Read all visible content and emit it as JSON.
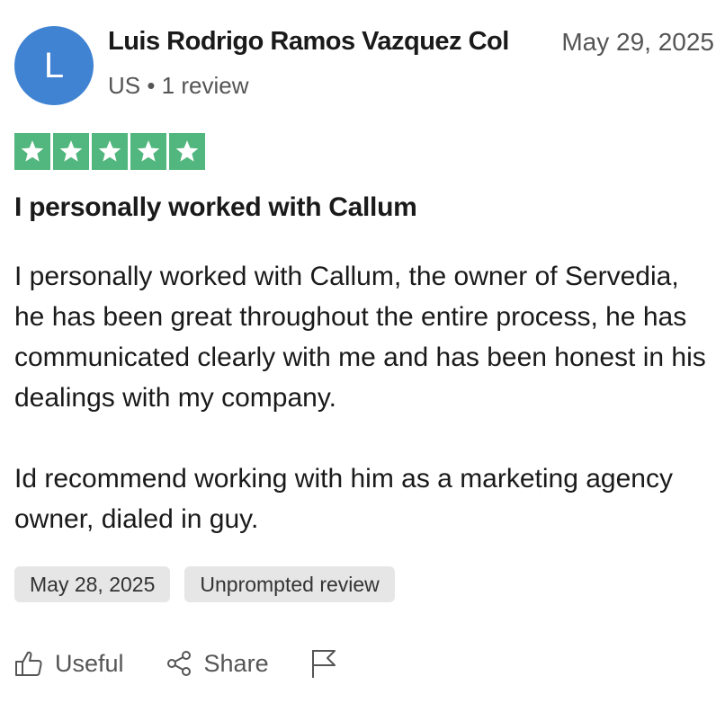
{
  "review": {
    "avatar_initial": "L",
    "avatar_color": "#3f83d2",
    "reviewer_name": "Luis Rodrigo Ramos Vazquez Col",
    "review_date": "May 29, 2025",
    "reviewer_meta": "US • 1 review",
    "rating": 5,
    "rating_max": 5,
    "star_color": "#52b77e",
    "title": "I personally worked with Callum",
    "body_paragraphs": [
      "I personally worked with Callum, the owner of Servedia, he has been great throughout the entire process, he has communicated clearly with me and has been honest in his dealings with my company.",
      "Id recommend working with him as a marketing agency owner, dialed in guy."
    ],
    "tags": [
      "May 28, 2025",
      "Unprompted review"
    ]
  },
  "actions": {
    "useful_label": "Useful",
    "useful_icon": "thumbs-up-icon",
    "share_label": "Share",
    "share_icon": "share-icon",
    "flag_icon": "flag-icon"
  }
}
